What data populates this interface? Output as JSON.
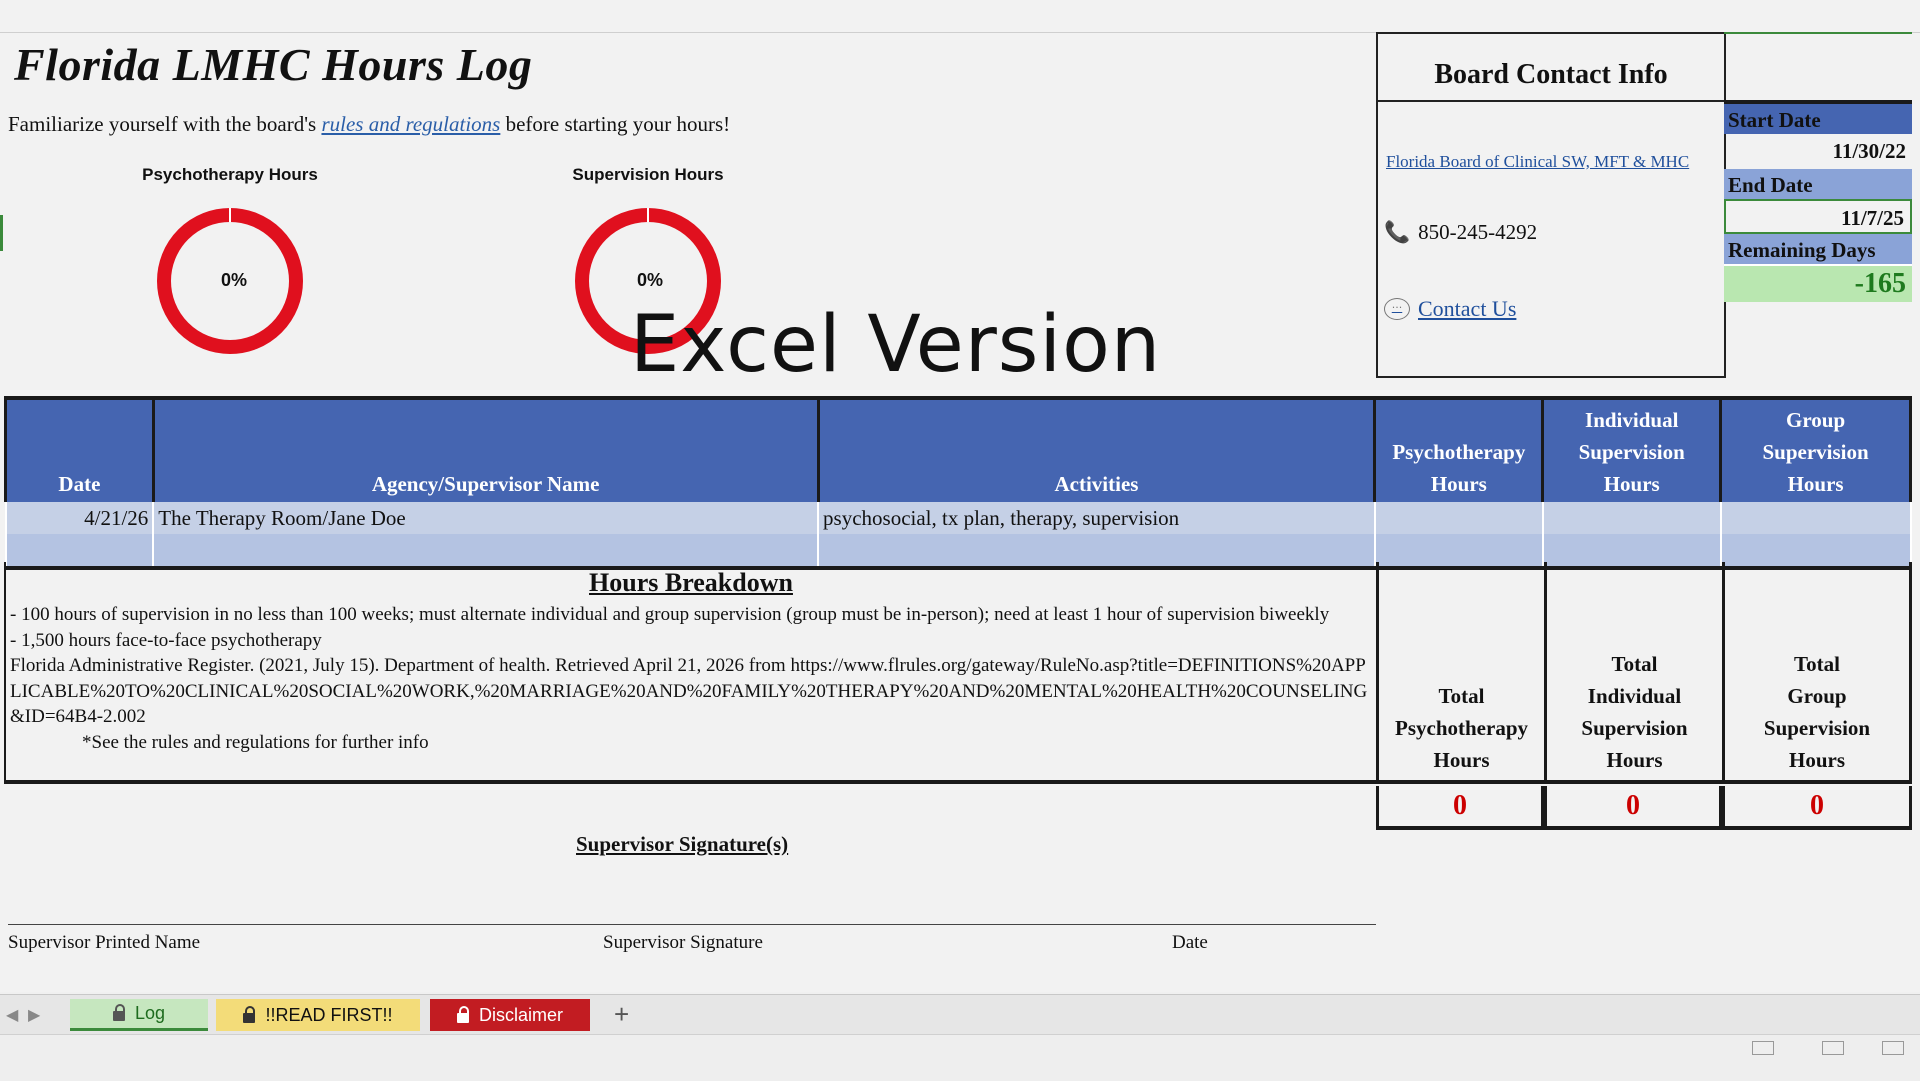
{
  "sheet": {
    "title": "Florida LMHC Hours Log",
    "intro_prefix": "Familiarize yourself with the board's ",
    "intro_link": "rules and regulations",
    "intro_suffix": " before starting your hours!",
    "watermark": "Excel Version"
  },
  "donuts": [
    {
      "label": "Psychotherapy Hours",
      "percent_text": "0%",
      "progress": 0,
      "color": "#e0101e"
    },
    {
      "label": "Supervision Hours",
      "percent_text": "0%",
      "progress": 0,
      "color": "#e0101e"
    }
  ],
  "contact": {
    "title": "Board Contact Info",
    "board_link": "Florida Board of Clinical SW, MFT & MHC",
    "phone": "850-245-4292",
    "contact_us": "Contact Us",
    "icons": {
      "phone": "phone-icon",
      "chat": "chat-icon"
    }
  },
  "dates": {
    "start_label": "Start Date",
    "start_value": "11/30/22",
    "end_label": "End Date",
    "end_value": "11/7/25",
    "remaining_label": "Remaining Days",
    "remaining_value": "-165"
  },
  "log_table": {
    "headers": {
      "date": "Date",
      "agency": "Agency/Supervisor Name",
      "activities": "Activities",
      "psychotherapy": [
        "Psychotherapy",
        "Hours"
      ],
      "individual": [
        "Individual",
        "Supervision",
        "Hours"
      ],
      "group": [
        "Group",
        "Supervision",
        "Hours"
      ]
    },
    "rows": [
      {
        "date": "4/21/26",
        "agency": "The Therapy Room/Jane Doe",
        "activities": "psychosocial, tx plan, therapy, supervision",
        "psychotherapy": "",
        "individual": "",
        "group": ""
      },
      {
        "date": "",
        "agency": "",
        "activities": "",
        "psychotherapy": "",
        "individual": "",
        "group": ""
      }
    ]
  },
  "breakdown": {
    "title": "Hours Breakdown",
    "line1": "- 100 hours of supervision in no less than 100 weeks; must alternate individual and group supervision (group must be in-person); need at least 1 hour of supervision biweekly",
    "line2": "- 1,500 hours face-to-face psychotherapy",
    "line3": "Florida Administrative Register. (2021, July 15). Department of health. Retrieved April 21, 2026 from https://www.flrules.org/gateway/RuleNo.asp?title=DEFINITIONS%20APPLICABLE%20TO%20CLINICAL%20SOCIAL%20WORK,%20MARRIAGE%20AND%20FAMILY%20THERAPY%20AND%20MENTAL%20HEALTH%20COUNSELING&ID=64B4-2.002",
    "line4": "*See the rules and regulations for further info"
  },
  "totals": {
    "psychotherapy_label": [
      "Total",
      "Psychotherapy",
      "Hours"
    ],
    "individual_label": [
      "Total",
      "Individual",
      "Supervision",
      "Hours"
    ],
    "group_label": [
      "Total",
      "Group",
      "Supervision",
      "Hours"
    ],
    "psychotherapy_value": "0",
    "individual_value": "0",
    "group_value": "0"
  },
  "signature": {
    "title": "Supervisor Signature(s)",
    "printed_name": "Supervisor Printed Name",
    "signature": "Supervisor Signature",
    "date": "Date"
  },
  "tabs": [
    {
      "label": "Log",
      "active": true,
      "bg": "#c6e7bf",
      "fg": "#1e6b1e"
    },
    {
      "label": "!!READ FIRST!!",
      "active": false,
      "bg": "#f3dc79",
      "fg": "#111111"
    },
    {
      "label": "Disclaimer",
      "active": false,
      "bg": "#c21c22",
      "fg": "#ffffff"
    }
  ],
  "colors": {
    "header_blue": "#4565b1",
    "row_light": "#c5d0e6",
    "remaining_green": "#b9e7b0",
    "total_red": "#cc0000"
  }
}
